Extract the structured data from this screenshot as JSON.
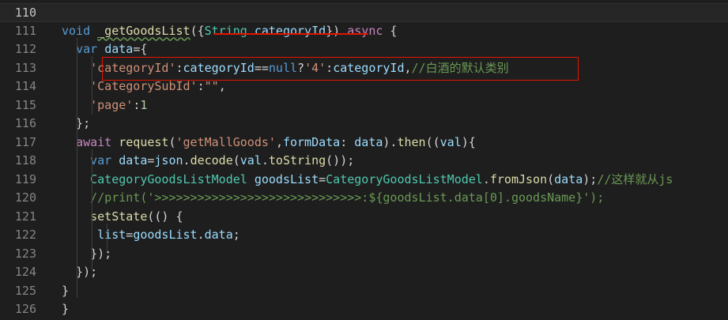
{
  "colors": {
    "background": "#1e1e1e",
    "keyword": "#569cd6",
    "control": "#c586c0",
    "function": "#dcdcaa",
    "variable": "#9cdcfe",
    "type": "#4ec9b0",
    "string": "#ce9178",
    "number": "#b5cea8",
    "comment": "#6a9955",
    "annotation": "#e51400"
  },
  "editor": {
    "lines": [
      {
        "num": "110",
        "tokens": [
          {
            "c": "t-id",
            "t": "  "
          }
        ]
      },
      {
        "num": "111",
        "tokens": [
          {
            "c": "t-kw",
            "t": "void"
          },
          {
            "c": "t-pun",
            "t": " "
          },
          {
            "c": "t-fn squiggle",
            "t": "_getGoodsList"
          },
          {
            "c": "t-pun",
            "t": "({"
          },
          {
            "c": "t-type",
            "t": "String"
          },
          {
            "c": "t-pun",
            "t": " "
          },
          {
            "c": "t-var",
            "t": "categoryId"
          },
          {
            "c": "t-pun",
            "t": "}) "
          },
          {
            "c": "t-ctl",
            "t": "async"
          },
          {
            "c": "t-pun",
            "t": " {"
          }
        ]
      },
      {
        "num": "112",
        "tokens": [
          {
            "c": "t-pun",
            "t": "  "
          },
          {
            "c": "t-kw",
            "t": "var"
          },
          {
            "c": "t-pun",
            "t": " "
          },
          {
            "c": "t-var",
            "t": "data"
          },
          {
            "c": "t-pun",
            "t": "={"
          }
        ]
      },
      {
        "num": "113",
        "tokens": [
          {
            "c": "t-pun",
            "t": "    "
          },
          {
            "c": "t-str",
            "t": "'categoryId'"
          },
          {
            "c": "t-pun",
            "t": ":"
          },
          {
            "c": "t-var",
            "t": "categoryId"
          },
          {
            "c": "t-pun",
            "t": "=="
          },
          {
            "c": "t-kw",
            "t": "null"
          },
          {
            "c": "t-pun",
            "t": "?"
          },
          {
            "c": "t-str",
            "t": "'4'"
          },
          {
            "c": "t-pun",
            "t": ":"
          },
          {
            "c": "t-var",
            "t": "categoryId"
          },
          {
            "c": "t-pun",
            "t": ","
          },
          {
            "c": "t-cmt",
            "t": "//白酒的默认类别"
          }
        ]
      },
      {
        "num": "114",
        "tokens": [
          {
            "c": "t-pun",
            "t": "    "
          },
          {
            "c": "t-str",
            "t": "'CategorySubId'"
          },
          {
            "c": "t-pun",
            "t": ":"
          },
          {
            "c": "t-str",
            "t": "\"\""
          },
          {
            "c": "t-pun",
            "t": ","
          }
        ]
      },
      {
        "num": "115",
        "tokens": [
          {
            "c": "t-pun",
            "t": "    "
          },
          {
            "c": "t-str",
            "t": "'page'"
          },
          {
            "c": "t-pun",
            "t": ":"
          },
          {
            "c": "t-num",
            "t": "1"
          }
        ]
      },
      {
        "num": "116",
        "tokens": [
          {
            "c": "t-pun",
            "t": "  };"
          }
        ]
      },
      {
        "num": "117",
        "tokens": [
          {
            "c": "t-pun",
            "t": "  "
          },
          {
            "c": "t-ctl",
            "t": "await"
          },
          {
            "c": "t-pun",
            "t": " "
          },
          {
            "c": "t-fn",
            "t": "request"
          },
          {
            "c": "t-pun",
            "t": "("
          },
          {
            "c": "t-str",
            "t": "'getMallGoods'"
          },
          {
            "c": "t-pun",
            "t": ","
          },
          {
            "c": "t-var",
            "t": "formData"
          },
          {
            "c": "t-pun",
            "t": ": "
          },
          {
            "c": "t-var",
            "t": "data"
          },
          {
            "c": "t-pun",
            "t": ")."
          },
          {
            "c": "t-fn",
            "t": "then"
          },
          {
            "c": "t-pun",
            "t": "(("
          },
          {
            "c": "t-var",
            "t": "val"
          },
          {
            "c": "t-pun",
            "t": "){"
          }
        ]
      },
      {
        "num": "118",
        "tokens": [
          {
            "c": "t-pun",
            "t": "    "
          },
          {
            "c": "t-kw",
            "t": "var"
          },
          {
            "c": "t-pun",
            "t": " "
          },
          {
            "c": "t-var",
            "t": "data"
          },
          {
            "c": "t-pun",
            "t": "="
          },
          {
            "c": "t-var",
            "t": "json"
          },
          {
            "c": "t-pun",
            "t": "."
          },
          {
            "c": "t-fn",
            "t": "decode"
          },
          {
            "c": "t-pun",
            "t": "("
          },
          {
            "c": "t-var",
            "t": "val"
          },
          {
            "c": "t-pun",
            "t": "."
          },
          {
            "c": "t-fn",
            "t": "toString"
          },
          {
            "c": "t-pun",
            "t": "());"
          }
        ]
      },
      {
        "num": "119",
        "tokens": [
          {
            "c": "t-pun",
            "t": "    "
          },
          {
            "c": "t-type",
            "t": "CategoryGoodsListModel"
          },
          {
            "c": "t-pun",
            "t": " "
          },
          {
            "c": "t-var",
            "t": "goodsList"
          },
          {
            "c": "t-pun",
            "t": "="
          },
          {
            "c": "t-type",
            "t": "CategoryGoodsListModel"
          },
          {
            "c": "t-pun",
            "t": "."
          },
          {
            "c": "t-fn",
            "t": "fromJson"
          },
          {
            "c": "t-pun",
            "t": "("
          },
          {
            "c": "t-var",
            "t": "data"
          },
          {
            "c": "t-pun",
            "t": ");"
          },
          {
            "c": "t-cmt",
            "t": "//这样就从js"
          }
        ]
      },
      {
        "num": "120",
        "tokens": [
          {
            "c": "t-pun",
            "t": "    "
          },
          {
            "c": "t-cmt",
            "t": "//print('>>>>>>>>>>>>>>>>>>>>>>>>>>>>>:${goodsList.data[0].goodsName}');"
          }
        ]
      },
      {
        "num": "121",
        "tokens": [
          {
            "c": "t-pun",
            "t": "    "
          },
          {
            "c": "t-fn",
            "t": "setState"
          },
          {
            "c": "t-pun",
            "t": "(() {"
          }
        ]
      },
      {
        "num": "122",
        "tokens": [
          {
            "c": "t-pun",
            "t": "     "
          },
          {
            "c": "t-var",
            "t": "list"
          },
          {
            "c": "t-pun",
            "t": "="
          },
          {
            "c": "t-var",
            "t": "goodsList"
          },
          {
            "c": "t-pun",
            "t": "."
          },
          {
            "c": "t-var",
            "t": "data"
          },
          {
            "c": "t-pun",
            "t": ";"
          }
        ]
      },
      {
        "num": "123",
        "tokens": [
          {
            "c": "t-pun",
            "t": "    });"
          }
        ]
      },
      {
        "num": "124",
        "tokens": [
          {
            "c": "t-pun",
            "t": "  });"
          }
        ]
      },
      {
        "num": "125",
        "tokens": [
          {
            "c": "t-pun",
            "t": "}"
          }
        ]
      },
      {
        "num": "126",
        "tokens": [
          {
            "c": "t-pun",
            "t": "}"
          }
        ]
      }
    ]
  }
}
